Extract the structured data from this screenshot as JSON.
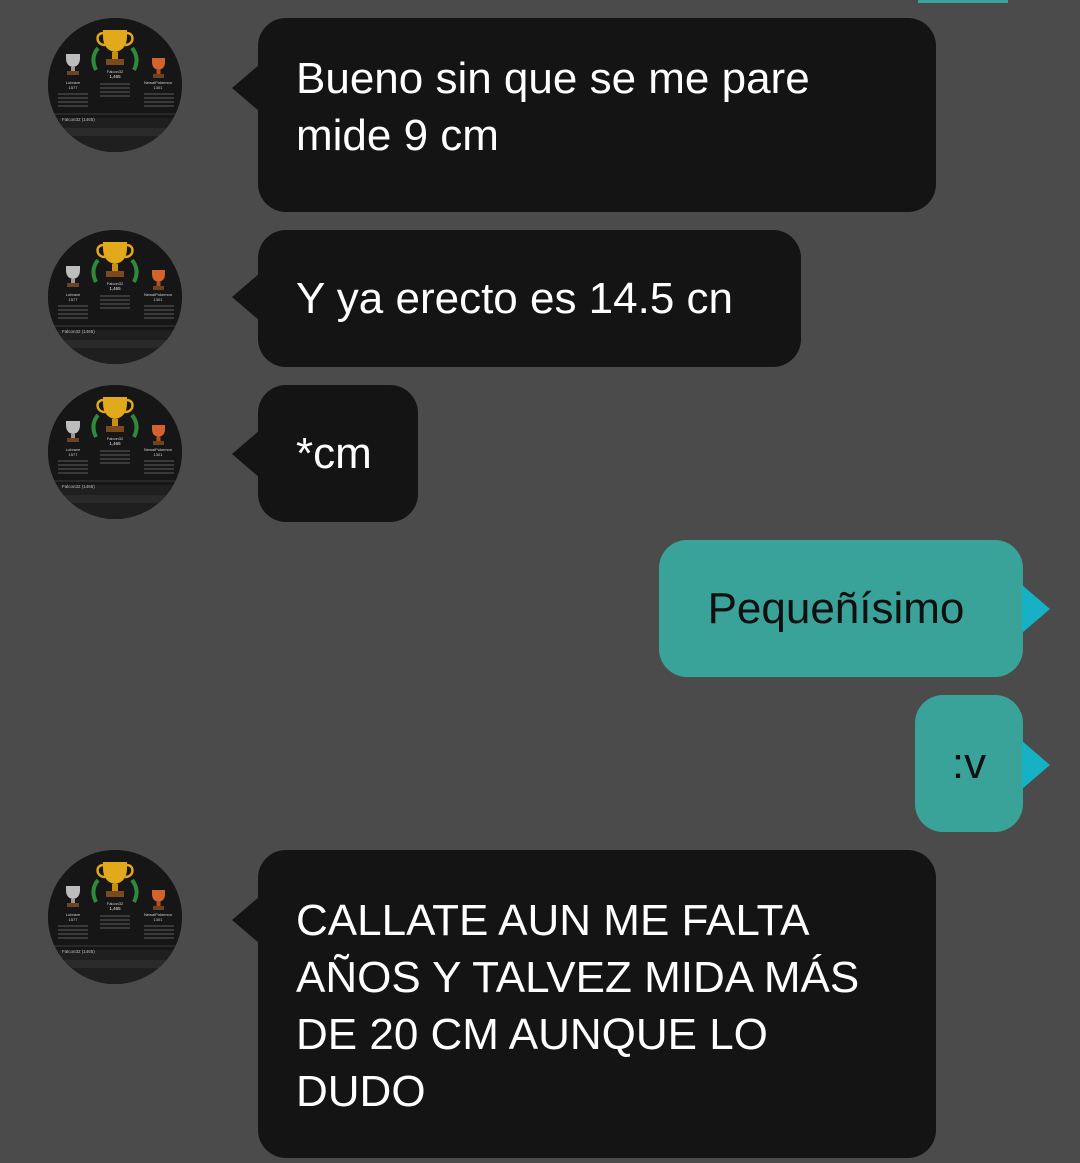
{
  "theme": {
    "background": "#4b4b4b",
    "incoming_bubble": "#141414",
    "outgoing_bubble": "#3aa399",
    "outgoing_tail": "#17b1c6",
    "accent_bar": "#3aa399"
  },
  "avatar": {
    "icon": "trophy-podium-avatar",
    "podium": {
      "left": {
        "name": "Lobrave",
        "score": "1577",
        "icon": "silver-trophy-icon"
      },
      "center": {
        "name": "Falcon32",
        "score": "1,465",
        "icon": "gold-trophy-icon"
      },
      "right": {
        "name": "NewalPokemon",
        "score": "1301",
        "icon": "bronze-trophy-icon"
      }
    },
    "footer_lines": [
      "Falcon32 (1465)",
      "(1577)"
    ]
  },
  "messages": [
    {
      "direction": "incoming",
      "text": "Bueno sin que se me pare\nmide 9 cm"
    },
    {
      "direction": "incoming",
      "text": "Y ya erecto es 14.5 cn"
    },
    {
      "direction": "incoming",
      "text": "*cm"
    },
    {
      "direction": "outgoing",
      "text": "Pequeñísimo"
    },
    {
      "direction": "outgoing",
      "text": ":v"
    },
    {
      "direction": "incoming",
      "text": "CALLATE AUN ME FALTA\nAÑOS Y TALVEZ MIDA MÁS\nDE 20 CM AUNQUE LO\nDUDO"
    }
  ]
}
